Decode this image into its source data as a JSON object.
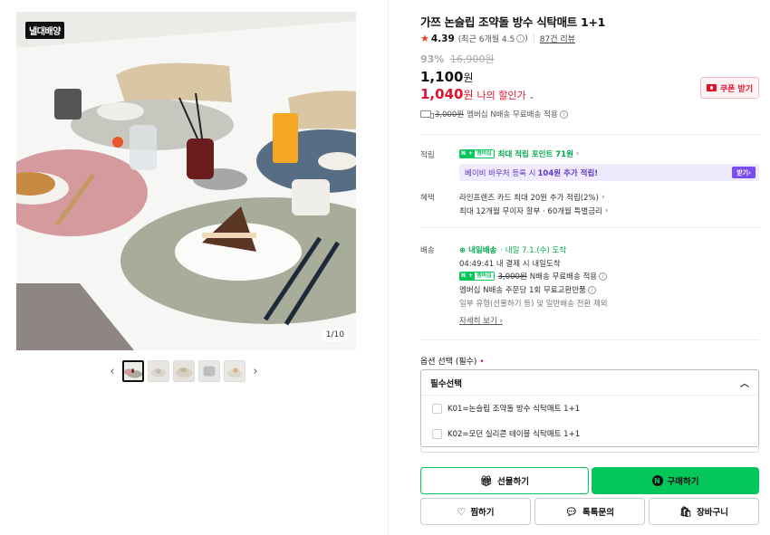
{
  "gallery": {
    "brand_badge": "낼대배양",
    "counter": "1/10",
    "prev_label": "‹",
    "next_label": "›"
  },
  "product": {
    "title": "가쯔 논슬립 조약돌 방수 식탁매트 1+1",
    "rating": "4.39",
    "rating_note": "(최근 6개월 4.5",
    "rating_note_end": ")",
    "review_count": "87건 리뷰",
    "discount_pct": "93%",
    "original_price": "16,900원",
    "price": "1,100",
    "price_unit": "원",
    "my_price": "1,040",
    "my_price_unit": "원",
    "my_discount_label": "나의 할인가",
    "coupon_button": "쿠폰 받기",
    "shipping_strike": "3,000원",
    "shipping_text": "멤버십 N배송 무료배송 적용"
  },
  "benefits": {
    "points_label": "적립",
    "points_badge_n": "N",
    "points_badge_plus": "+",
    "points_badge_mem": "멤버십",
    "points_text": "최대 적립 포인트 71원",
    "promo_prefix": "베이비 바우처 등록 시",
    "promo_amount": "104원 추가 적립!",
    "promo_button": "받기",
    "perks_label": "혜택",
    "perk_1": "라인프렌즈 카드 최대 20원 추가 적립(2%)",
    "perk_2": "최대 12개월 무이자 할부 · 60개월 특별금리"
  },
  "delivery": {
    "label": "배송",
    "tomorrow": "내일배송",
    "tomorrow_date": "· 내일 7.1.(수) 도착",
    "deadline": "04:49:41 내 결제 시 내일도착",
    "ship_strike": "3,000원",
    "ship_text": "N배송 무료배송 적용",
    "exchange": "멤버십 N배송 주문당 1회 무료교환반품",
    "exclusion": "일부 유형(선물하기 등) 및 일반배송 전환 제외",
    "detail_link": "자세히 보기"
  },
  "options": {
    "label": "옵션 선택 (필수)",
    "required_mark": "•",
    "select_title": "필수선택",
    "items": [
      {
        "label": "K01=논슬립 조약돌 방수 식탁매트 1+1"
      },
      {
        "label": "K02=모던 실리콘 테이블 식탁매트 1+1"
      }
    ]
  },
  "actions": {
    "gift": "선물하기",
    "buy": "구매하기",
    "buy_logo": "N",
    "zzim": "찜하기",
    "talk": "톡톡문의",
    "cart": "장바구니"
  },
  "colors": {
    "accent_green": "#03c75a",
    "sale_red": "#e0112b",
    "promo_purple": "#7b4cf0"
  },
  "icons": {
    "star": "star-icon",
    "truck": "truck-icon",
    "gift": "gift-icon",
    "heart": "heart-icon",
    "chat": "chat-icon",
    "cart": "cart-icon"
  }
}
